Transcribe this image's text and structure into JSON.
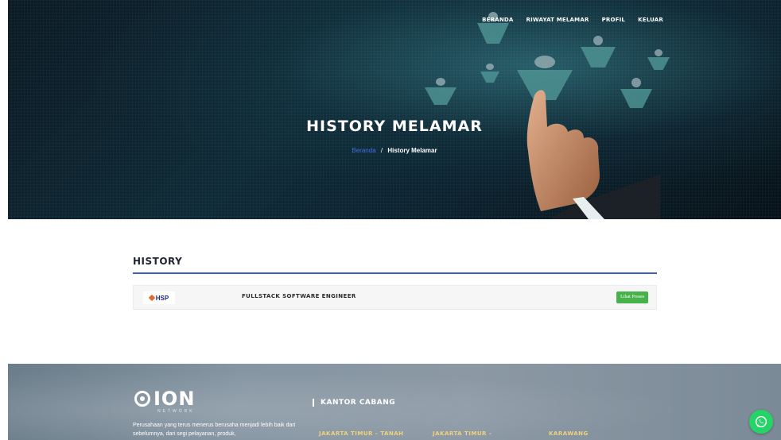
{
  "nav": {
    "items": [
      {
        "label": "BERANDA"
      },
      {
        "label": "RIWAYAT MELAMAR"
      },
      {
        "label": "PROFIL"
      },
      {
        "label": "KELUAR"
      }
    ]
  },
  "hero": {
    "title": "HISTORY MELAMAR",
    "breadcrumb": {
      "home": "Beranda",
      "separator": "/",
      "current": "History Melamar"
    }
  },
  "history": {
    "heading": "HISTORY",
    "rows": [
      {
        "company_logo_text": "HSP",
        "job_title": "FULLSTACK SOFTWARE ENGINEER",
        "button_label": "Lihat Proses"
      }
    ]
  },
  "footer": {
    "logo_text": "ION",
    "logo_sub": "NETWORK",
    "description": "Perusahaan yang terus menerus berusaha menjadi lebih baik dari sebelumnya, dari segi pelayanan, produk,",
    "kantor_heading": "KANTOR CABANG",
    "branches": [
      "JAKARTA TIMUR - TANAH",
      "JAKARTA TIMUR -",
      "KARAWANG"
    ]
  },
  "icons": {
    "whatsapp": "whatsapp-icon"
  },
  "colors": {
    "accent_blue": "#3b5bc5",
    "button_green": "#48b24a",
    "whatsapp_green": "#25d366",
    "branch_gold": "#f2d37a"
  }
}
